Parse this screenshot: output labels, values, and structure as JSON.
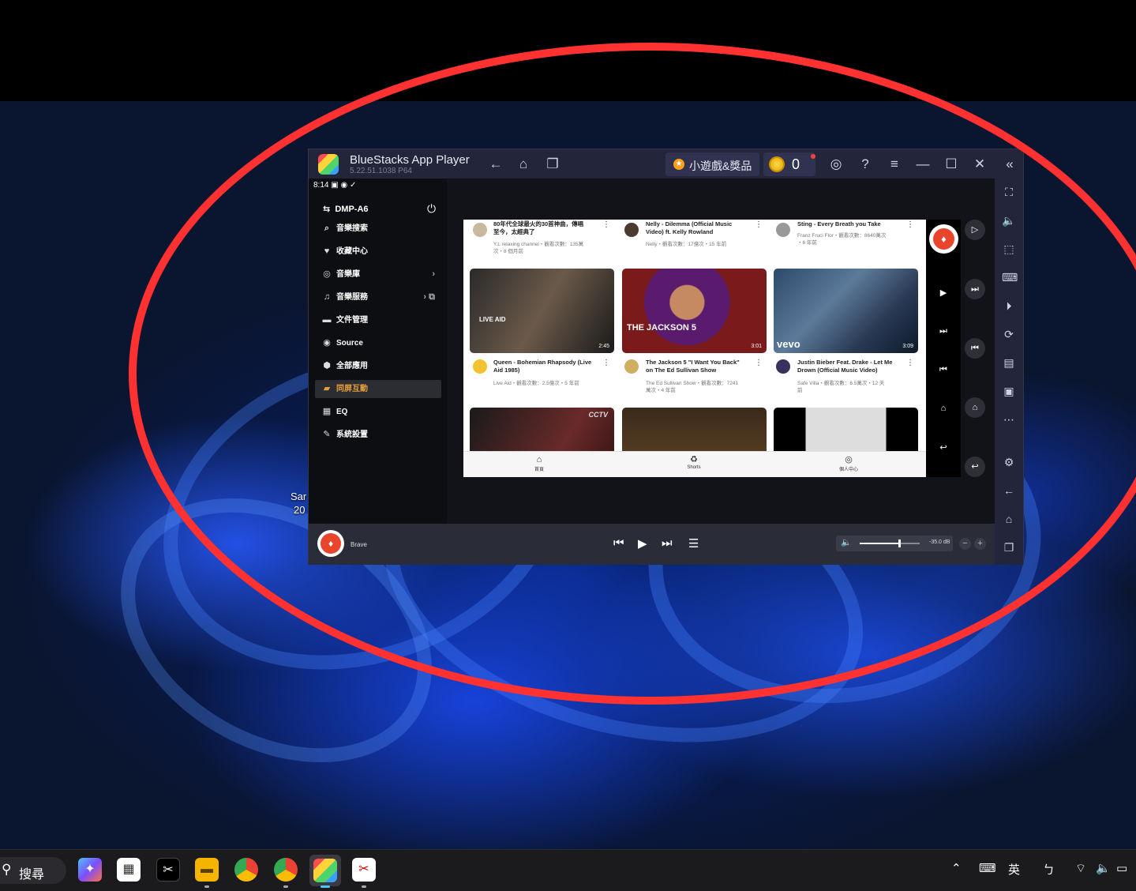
{
  "desktop": {
    "icon_label_line1": "Sar",
    "icon_label_line2": "20"
  },
  "window": {
    "app_name": "BlueStacks App Player",
    "version": "5.22.51.1038  P64",
    "promo_label": "小遊戲&獎品",
    "coins": "0",
    "icons": [
      "back-icon",
      "home-icon",
      "recent-apps-icon",
      "account-icon",
      "help-icon",
      "menu-icon",
      "minimize-icon",
      "maximize-icon",
      "close-icon",
      "collapse-sidebar-icon"
    ]
  },
  "android": {
    "status_time": "8:14",
    "sidebar": {
      "device": "DMP-A6",
      "items": [
        {
          "label": "音樂搜索",
          "icon": "search-icon"
        },
        {
          "label": "收藏中心",
          "icon": "heart-icon"
        },
        {
          "label": "音樂庫",
          "icon": "library-icon"
        },
        {
          "label": "音樂服務",
          "icon": "music-note-icon"
        },
        {
          "label": "文件管理",
          "icon": "folder-icon"
        },
        {
          "label": "Source",
          "icon": "source-icon"
        },
        {
          "label": "全部應用",
          "icon": "apps-icon"
        },
        {
          "label": "同屏互動",
          "icon": "cast-icon"
        },
        {
          "label": "EQ",
          "icon": "eq-icon"
        },
        {
          "label": "系統設置",
          "icon": "wrench-icon"
        }
      ],
      "active_index": 7
    },
    "youtube": {
      "top_videos": [
        {
          "title1": "80年代全球最火的30首神曲，傳唱",
          "title2": "至今，太經典了",
          "sub1": "Y.L relaxing channel・觀看次數：135萬",
          "sub2": "次・8 個月前"
        },
        {
          "title1": "Nelly - Dilemma (Official Music",
          "title2": "Video) ft. Kelly Rowland",
          "sub1": "Nelly・觀看次數：17億次・15 年前",
          "sub2": ""
        },
        {
          "title1": "Sting - Every Breath you Take",
          "title2": "",
          "sub1": "Franz Fruci Flor・觀看次數：8640萬次",
          "sub2": "・6 年前"
        }
      ],
      "middle_videos": [
        {
          "duration": "2:45",
          "title1": "Queen - Bohemian Rhapsody (Live",
          "title2": "Aid 1985)",
          "sub1": "Live Aid・觀看次數：2.5億次・5 年前",
          "sub2": "",
          "thumb_text": "LIVE AID"
        },
        {
          "duration": "3:01",
          "title1": "The Jackson 5 \"I Want You Back\"",
          "title2": "on The Ed Sullivan Show",
          "sub1": "The Ed Sullivan Show・觀看次數：7241",
          "sub2": "萬次・4 年前",
          "thumb_text": "THE JACKSON 5"
        },
        {
          "duration": "3:09",
          "title1": "Justin Bieber Feat. Drake - Let Me",
          "title2": "Drown (Official Music Video)",
          "sub1": "Safe Villa・觀看次數：6.5萬次・12 天",
          "sub2": "前",
          "thumb_text": "vevo"
        }
      ],
      "bottom_thumb_text": "CCTV",
      "nav": [
        "首頁",
        "Shorts",
        "個人中心"
      ]
    },
    "player": {
      "source": "Brave",
      "volume_db": "-35.0 dB",
      "volume_level": 0.66
    }
  },
  "taskbar": {
    "search_label": "搜尋",
    "ime_label": "英",
    "apps": [
      "copilot-icon",
      "store-icon",
      "capcut-icon",
      "file-explorer-icon",
      "chrome-icon",
      "chrome-profile-icon",
      "bluestacks-icon",
      "snipping-tool-icon"
    ]
  },
  "colors": {
    "annotation": "#ff3131",
    "accent_active": "#e8a13a",
    "window_bg": "#23263a"
  }
}
